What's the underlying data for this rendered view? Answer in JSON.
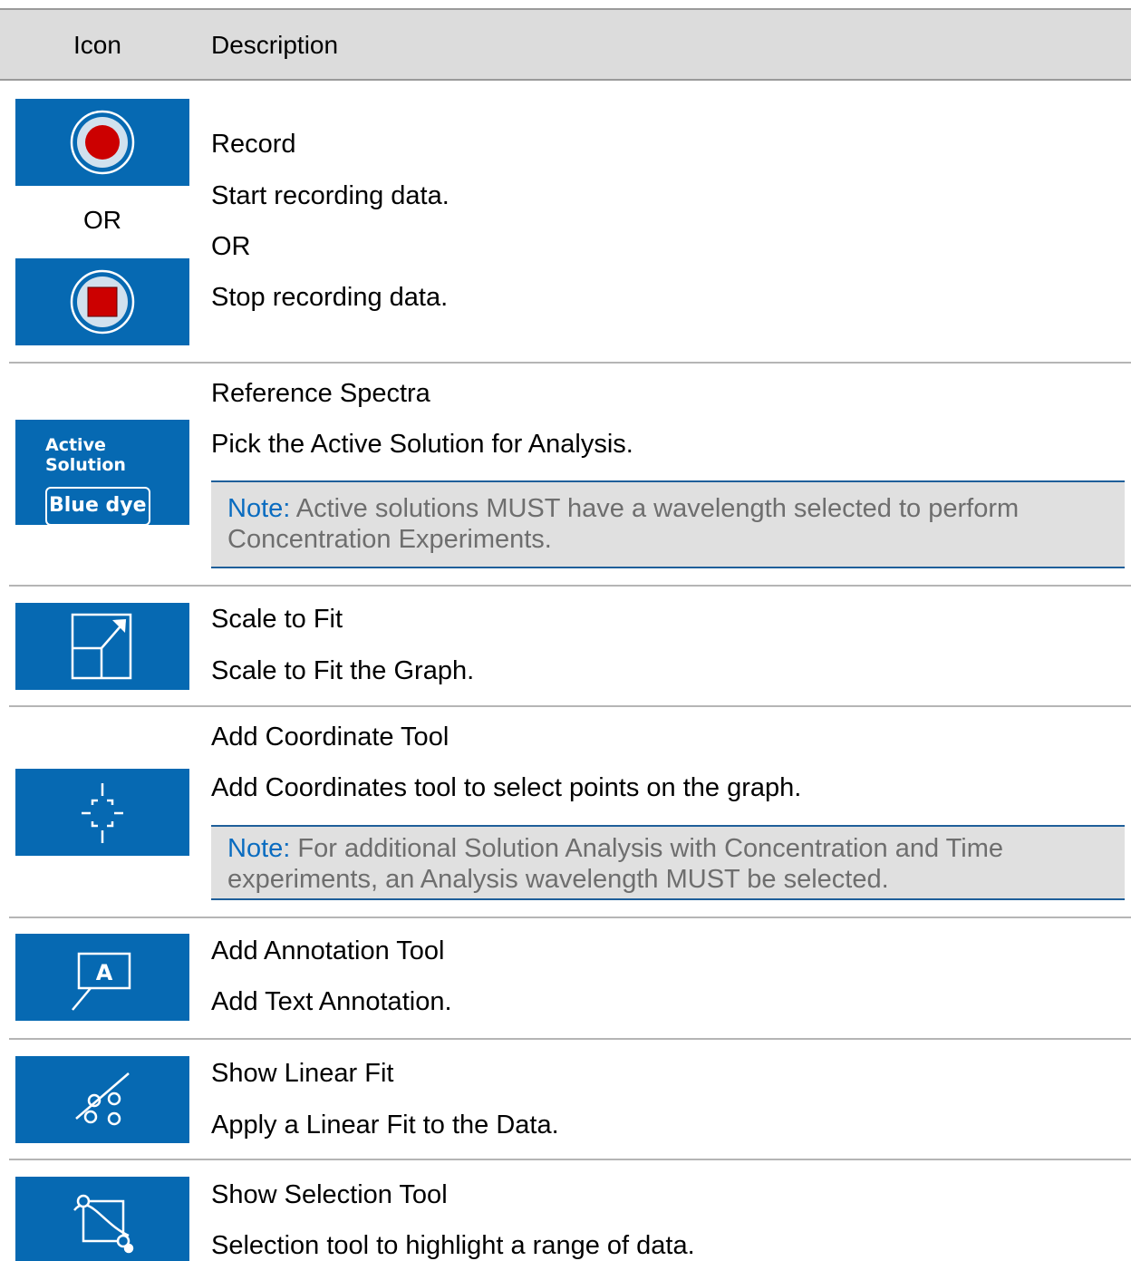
{
  "header": {
    "icon_col": "Icon",
    "desc_col": "Description"
  },
  "colors": {
    "icon_bg": "#0669b2",
    "record_red": "#cc0000",
    "note_bg": "#e0e0e0",
    "note_accent": "#0a6cc0",
    "header_bg": "#dcdcdc"
  },
  "rows": [
    {
      "icons": [
        "record-start-icon",
        "record-stop-icon"
      ],
      "or_label": "OR",
      "title": "Record",
      "lines": [
        "Start recording data.",
        "OR",
        "Stop recording data."
      ]
    },
    {
      "icon": "active-solution-selector",
      "icon_text_top": "Active Solution",
      "icon_text_box": "Blue dye",
      "title": "Reference Spectra",
      "desc": "Pick the Active Solution for Analysis.",
      "note": {
        "lead": "Note:",
        "text": " Active solutions MUST have a wavelength selected to perform Concentration Experiments."
      }
    },
    {
      "icon": "scale-to-fit-icon",
      "title": "Scale to Fit",
      "desc": "Scale to Fit the Graph."
    },
    {
      "icon": "coordinate-tool-icon",
      "title": "Add Coordinate Tool",
      "desc": "Add Coordinates tool to select points on the graph.",
      "note": {
        "lead": "Note:",
        "text": " For additional Solution Analysis with Concentration and Time experiments, an Analysis wavelength MUST be selected."
      }
    },
    {
      "icon": "annotation-tool-icon",
      "icon_letter": "A",
      "title": "Add Annotation Tool",
      "desc": "Add Text Annotation."
    },
    {
      "icon": "linear-fit-icon",
      "title": "Show Linear Fit",
      "desc": "Apply a Linear Fit to the Data."
    },
    {
      "icon": "selection-tool-icon",
      "title": "Show Selection Tool",
      "desc": "Selection tool to highlight a range of data."
    }
  ]
}
